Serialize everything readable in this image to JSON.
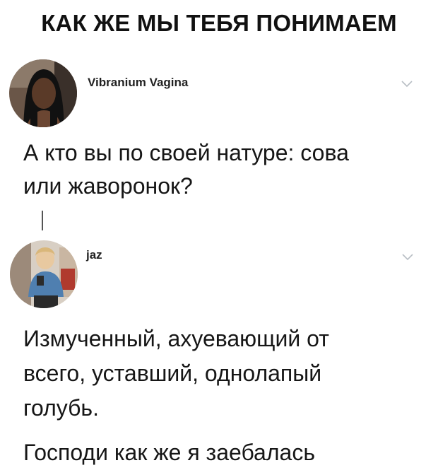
{
  "headline": "КАК ЖЕ МЫ ТЕБЯ ПОНИМАЕМ",
  "tweet1": {
    "author": "Vibranium Vagina",
    "avatar_icon": "user-avatar",
    "menu_icon": "chevron-down-icon",
    "text_line1": "А кто вы по своей натуре: сова",
    "text_line2": "или жаворонок?"
  },
  "tweet2": {
    "author": "jaz",
    "avatar_icon": "user-avatar",
    "menu_icon": "chevron-down-icon",
    "text_line1": "Измученный, ахуевающий от",
    "text_line2": "всего, уставший, однолапый",
    "text_line3": "голубь.",
    "text_line4": "Господи как же я заебалась"
  },
  "colors": {
    "text": "#161616",
    "chevron": "#b8bec4",
    "thread_line": "#555555"
  }
}
